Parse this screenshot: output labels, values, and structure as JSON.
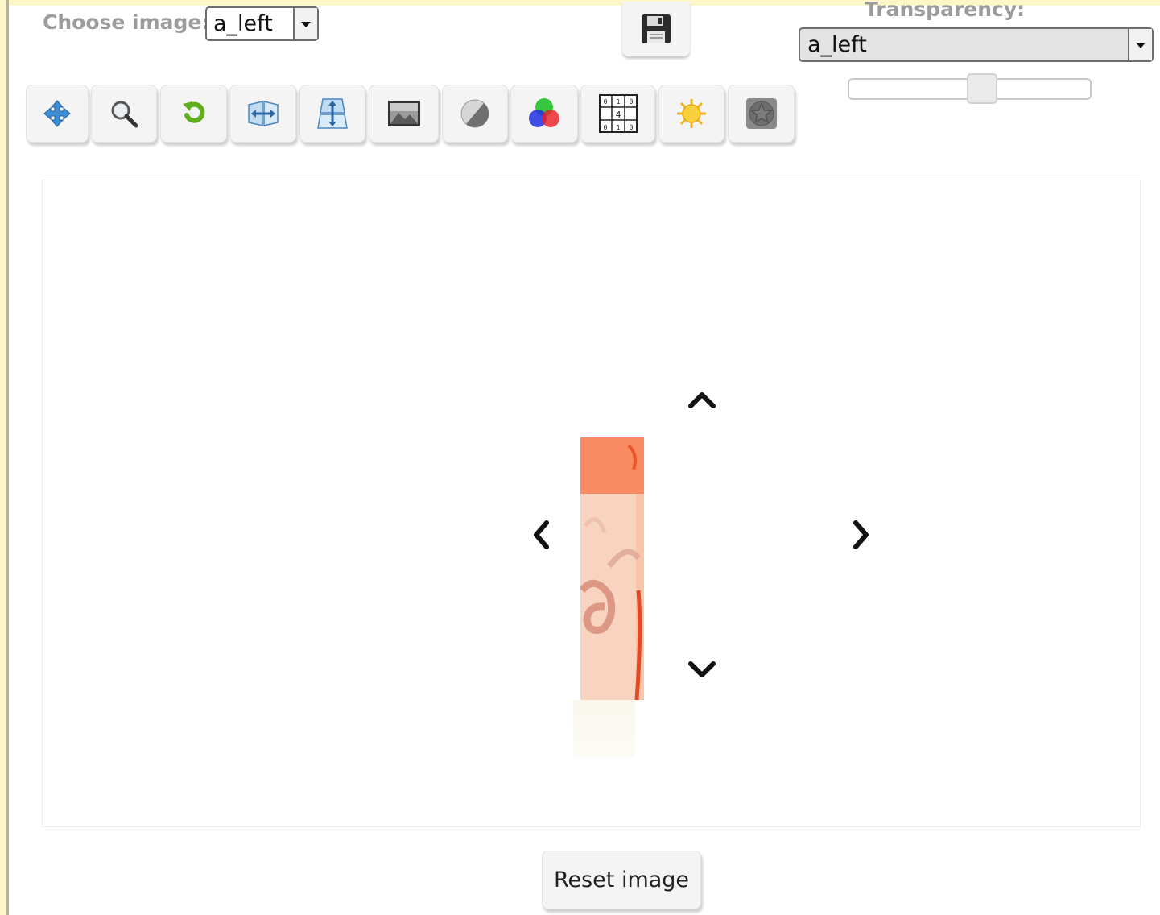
{
  "controls": {
    "choose_label": "Choose image:",
    "choose_selected": "a_left",
    "transparency_label": "Transparency:",
    "transparency_selected": "a_left",
    "transparency_level": 0.56
  },
  "toolbar": {
    "buttons": [
      {
        "name": "move-tool-button",
        "icon": "move-icon"
      },
      {
        "name": "zoom-tool-button",
        "icon": "magnifier-icon"
      },
      {
        "name": "rotate-tool-button",
        "icon": "rotate-icon"
      },
      {
        "name": "flip-horizontal-button",
        "icon": "flip-horizontal-icon"
      },
      {
        "name": "flip-vertical-button",
        "icon": "flip-vertical-icon"
      },
      {
        "name": "grayscale-button",
        "icon": "picture-icon"
      },
      {
        "name": "contrast-button",
        "icon": "contrast-icon"
      },
      {
        "name": "color-channels-button",
        "icon": "rgb-circles-icon"
      },
      {
        "name": "tile-grid-button",
        "icon": "number-grid-icon"
      },
      {
        "name": "brightness-button",
        "icon": "sun-icon"
      },
      {
        "name": "effect-button",
        "icon": "star-badge-icon"
      }
    ],
    "save_icon": "floppy-disk-icon"
  },
  "workspace": {
    "image_icon": "manuscript-fragment-image",
    "arrows": [
      "arrow-up-icon",
      "arrow-left-icon",
      "arrow-right-icon",
      "arrow-down-icon"
    ]
  },
  "reset_label": "Reset image",
  "colors": {
    "background_strip": "#fdf6c8",
    "fragment_top": "#f98a61",
    "fragment_body": "#f9c7ae",
    "ink_red": "#e24a24"
  }
}
